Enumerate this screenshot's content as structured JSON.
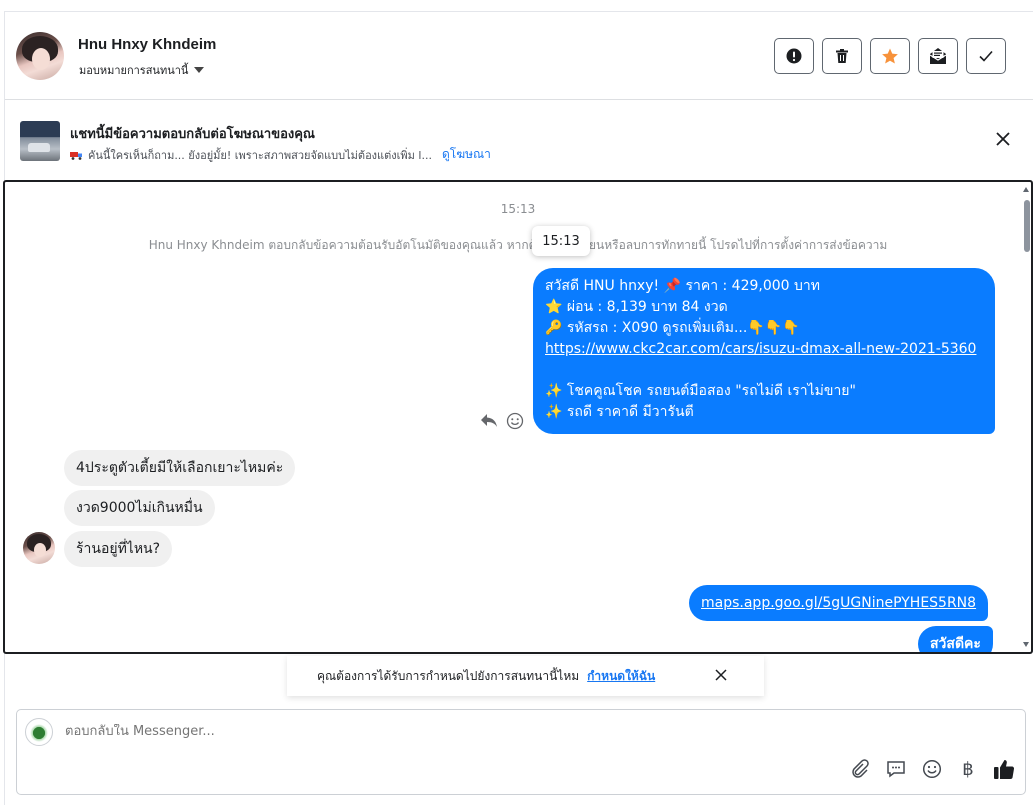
{
  "header": {
    "contact_name": "Hnu Hnxy Khndeim",
    "assign_label": "มอบหมายการสนทนานี้",
    "actions": [
      {
        "name": "report-button",
        "icon": "exclamation-icon"
      },
      {
        "name": "delete-button",
        "icon": "trash-icon"
      },
      {
        "name": "star-button",
        "icon": "star-icon",
        "color": "#f7923b"
      },
      {
        "name": "mark-unread-button",
        "icon": "envelope-open-icon"
      },
      {
        "name": "done-button",
        "icon": "check-icon"
      }
    ]
  },
  "ad_banner": {
    "title": "แชทนี้มีข้อความตอบกลับต่อโฆษณาของคุณ",
    "subtitle": "คันนี้ใครเห็นก็ถาม... ยังอยู่มั้ย! เพราะสภาพสวยจัดแบบไม่ต้องแต่งเพิ่ม l...",
    "view_ad_label": "ดูโฆษณา"
  },
  "conversation": {
    "time_header": "15:13",
    "system_message": "Hnu Hnxy Khndeim ตอบกลับข้อความต้อนรับอัตโนมัติของคุณแล้ว หากต้องการเปลี่ยนหรือลบการทักทายนี้ โปรดไปที่การตั้งค่าการส่งข้อความ",
    "tooltip_time": "15:13",
    "welcome_message": {
      "line1": "สวัสดี HNU hnxy! 📌 ราคา : 429,000 บาท",
      "line2": "⭐ ผ่อน : 8,139 บาท 84 งวด",
      "line3": "🔑 รหัสรถ : X090  ดูรถเพิ่มเติม...👇👇👇",
      "link": "https://www.ckc2car.com/cars/isuzu-dmax-all-new-2021-5360",
      "line5": "✨ โชคคูณโชค รถยนต์มือสอง \"รถไม่ดี เราไม่ขาย\"",
      "line6": "✨ รถดี ราคาดี มีวารันตี"
    },
    "incoming": [
      "4ประตูตัวเตี้ยมีให้เลือกเยาะไหมค่ะ",
      "งวด9000ไม่เกินหมื่น",
      "ร้านอยู่ที่ไหน?"
    ],
    "outgoing_link": "maps.app.goo.gl/5gUGNinePYHES5RN8",
    "outgoing_greeting": "สวัสดีคะ",
    "bubble_color": "#0a7cff"
  },
  "assign_prompt": {
    "text": "คุณต้องการได้รับการกำหนดไปยังการสนทนานี้ไหม",
    "action_label": "กำหนดให้ฉัน"
  },
  "composer": {
    "placeholder": "ตอบกลับใน Messenger...",
    "tools": [
      "paperclip-icon",
      "saved-reply-icon",
      "emoji-icon",
      "baht-icon",
      "thumbs-up-icon"
    ],
    "baht_symbol": "฿"
  }
}
